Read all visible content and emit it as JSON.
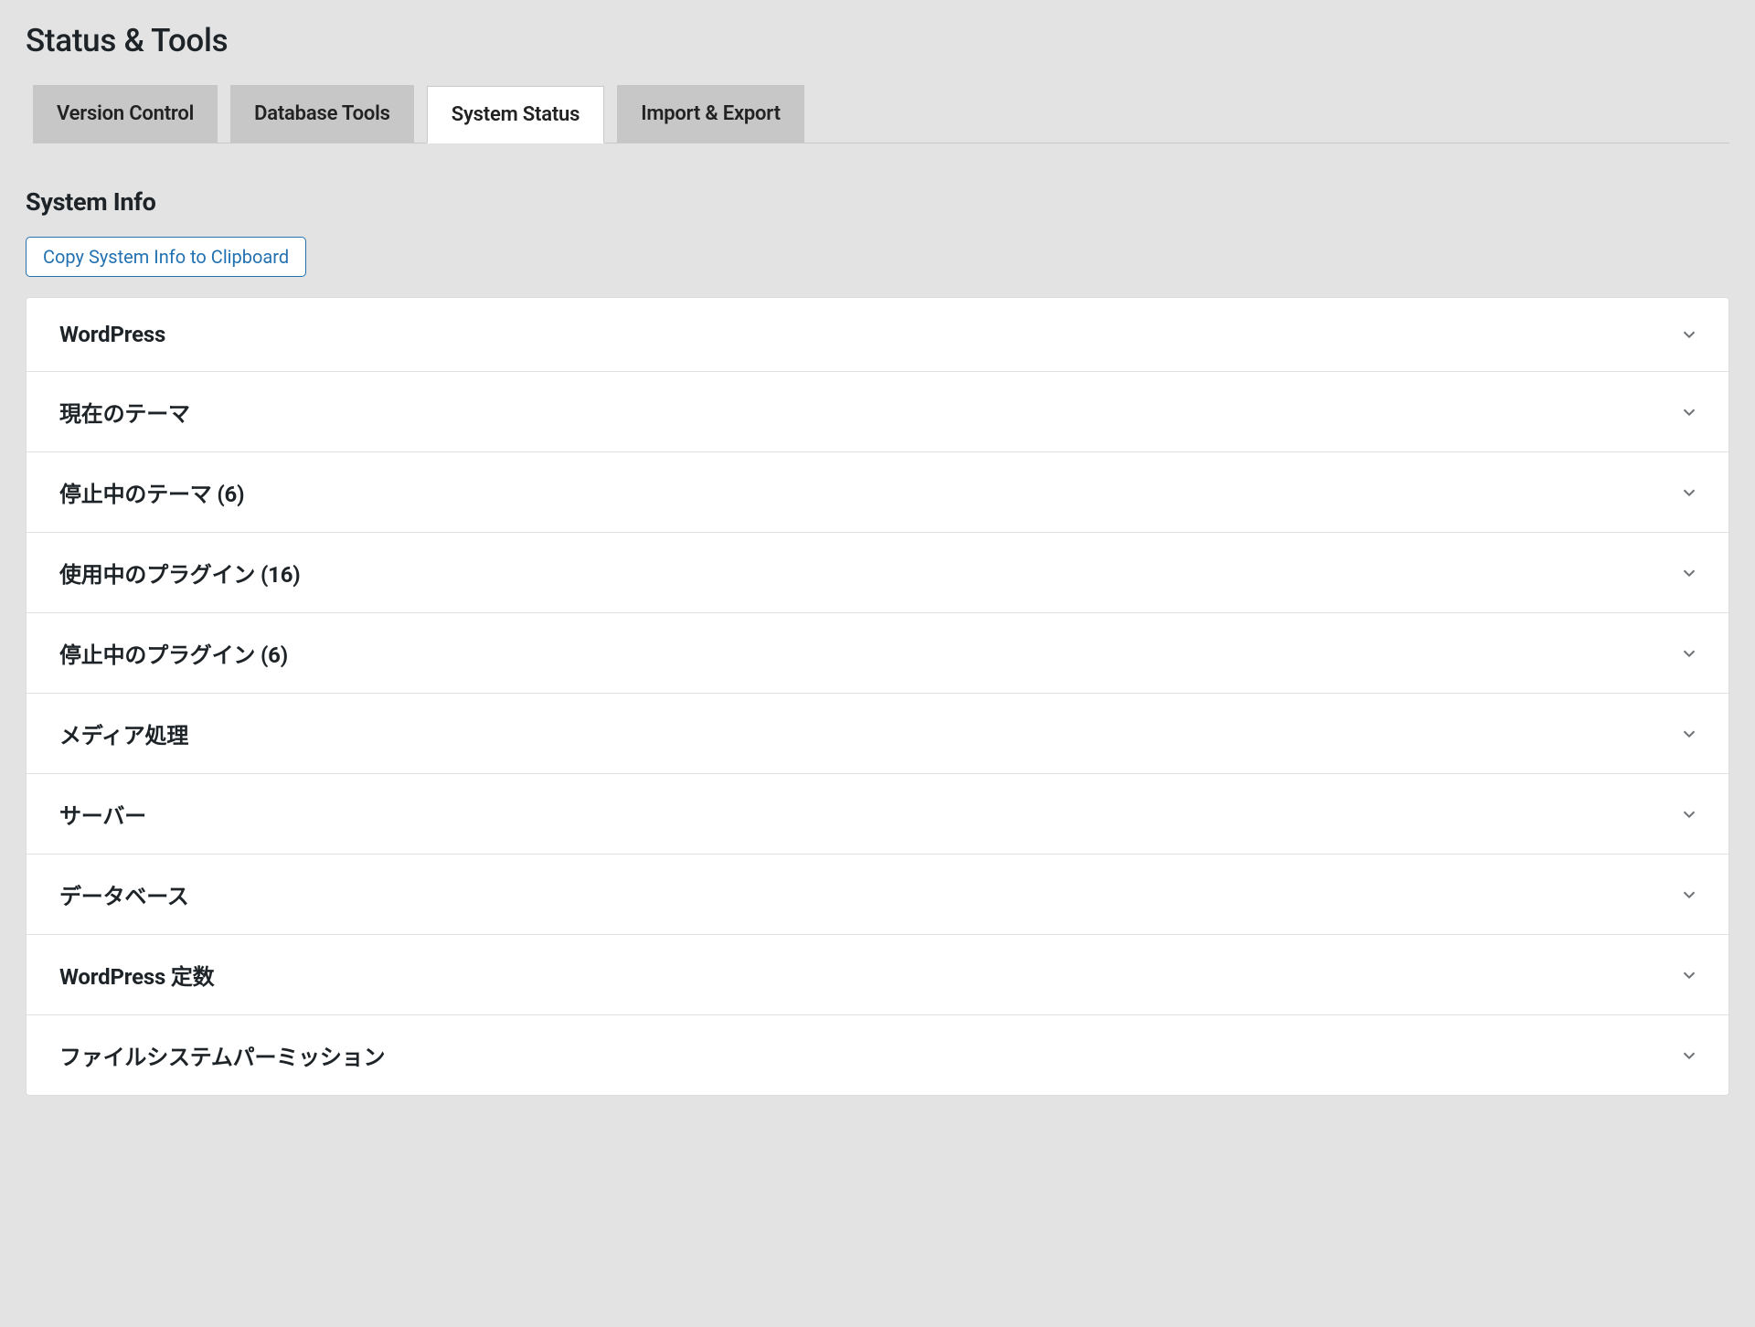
{
  "page": {
    "title": "Status & Tools"
  },
  "tabs": [
    {
      "label": "Version Control",
      "active": false
    },
    {
      "label": "Database Tools",
      "active": false
    },
    {
      "label": "System Status",
      "active": true
    },
    {
      "label": "Import & Export",
      "active": false
    }
  ],
  "section": {
    "title": "System Info",
    "copy_button_label": "Copy System Info to Clipboard"
  },
  "accordion": [
    {
      "label": "WordPress"
    },
    {
      "label": "現在のテーマ"
    },
    {
      "label": "停止中のテーマ (6)"
    },
    {
      "label": "使用中のプラグイン (16)"
    },
    {
      "label": "停止中のプラグイン (6)"
    },
    {
      "label": "メディア処理"
    },
    {
      "label": "サーバー"
    },
    {
      "label": "データベース"
    },
    {
      "label": "WordPress 定数"
    },
    {
      "label": "ファイルシステムパーミッション"
    }
  ]
}
